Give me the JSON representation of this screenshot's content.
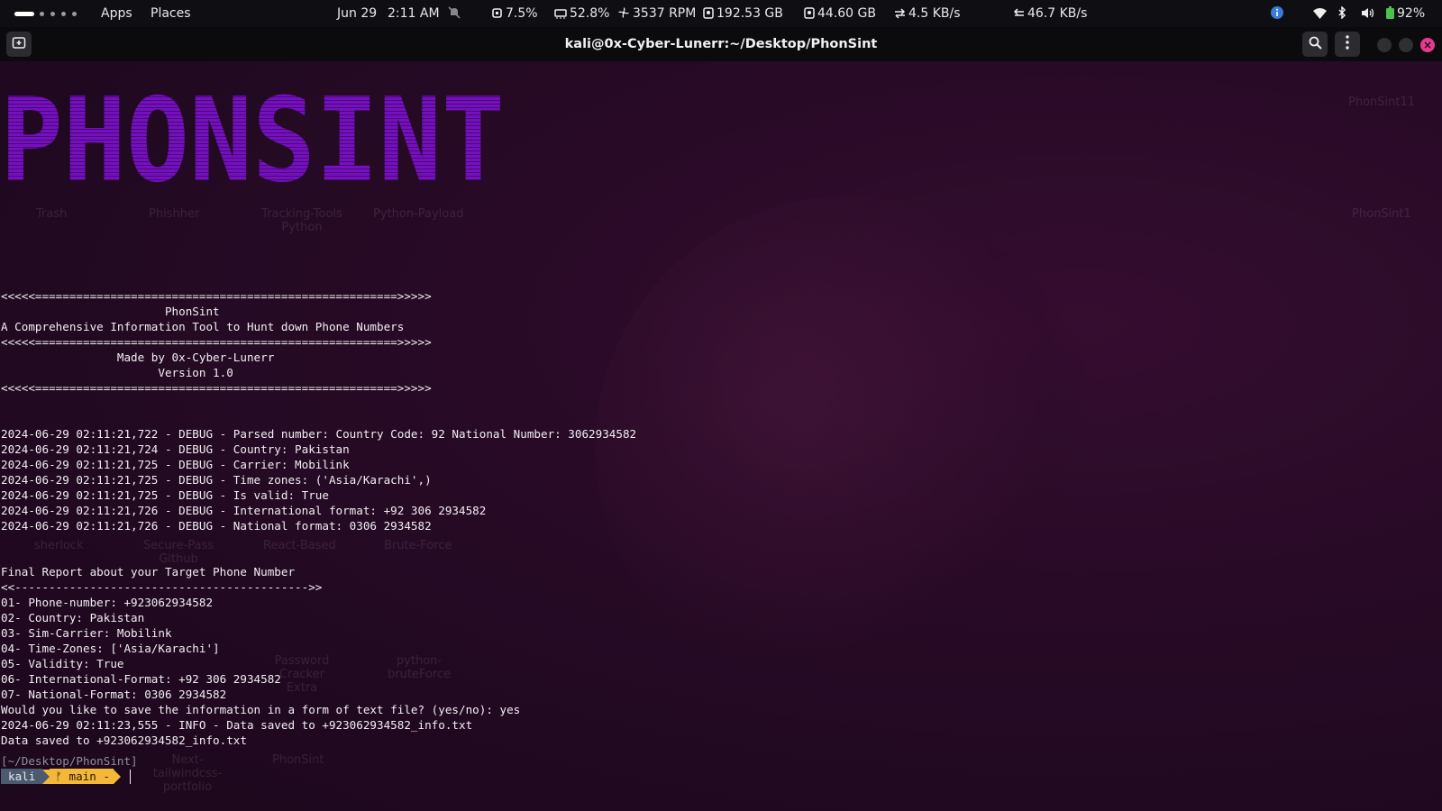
{
  "topbar": {
    "menu_apps": "Apps",
    "menu_places": "Places",
    "date": "Jun 29",
    "time": "2:11 AM",
    "cpu": "7.5%",
    "memory": "52.8%",
    "fan": "3537 RPM",
    "disk1": "192.53 GB",
    "disk2": "44.60 GB",
    "net_up": "4.5 KB/s",
    "net_down": "46.7 KB/s",
    "battery": "92%",
    "icons": [
      "notifications-off-icon",
      "cpu-icon",
      "memory-icon",
      "fan-icon",
      "disk-icon",
      "disk-icon",
      "upload-icon",
      "download-icon",
      "info-icon",
      "wifi-icon",
      "bluetooth-icon",
      "volume-icon",
      "battery-icon"
    ]
  },
  "window": {
    "title": "kali@0x-Cyber-Lunerr:~/Desktop/PhonSint",
    "buttons": [
      "new-tab-icon",
      "search-icon",
      "menu-icon",
      "minimize-button",
      "maximize-button",
      "close-button"
    ]
  },
  "terminal": {
    "banner": "PHONSINT",
    "lines": [
      "<<<<<=====================================================>>>>>",
      "                        PhonSint",
      "A Comprehensive Information Tool to Hunt down Phone Numbers",
      "<<<<<=====================================================>>>>>",
      "                 Made by 0x-Cyber-Lunerr",
      "                       Version 1.0",
      "<<<<<=====================================================>>>>>",
      "",
      "",
      "2024-06-29 02:11:21,722 - DEBUG - Parsed number: Country Code: 92 National Number: 3062934582",
      "2024-06-29 02:11:21,724 - DEBUG - Country: Pakistan",
      "2024-06-29 02:11:21,725 - DEBUG - Carrier: Mobilink",
      "2024-06-29 02:11:21,725 - DEBUG - Time zones: ('Asia/Karachi',)",
      "2024-06-29 02:11:21,725 - DEBUG - Is valid: True",
      "2024-06-29 02:11:21,726 - DEBUG - International format: +92 306 2934582",
      "2024-06-29 02:11:21,726 - DEBUG - National format: 0306 2934582",
      "",
      "",
      "Final Report about your Target Phone Number",
      "<<------------------------------------------->>",
      "01- Phone-number: +923062934582",
      "02- Country: Pakistan",
      "03- Sim-Carrier: Mobilink",
      "04- Time-Zones: ['Asia/Karachi']",
      "05- Validity: True",
      "06- International-Format: +92 306 2934582",
      "07- National-Format: 0306 2934582",
      "Would you like to save the information in a form of text file? (yes/no): yes",
      "2024-06-29 02:11:23,555 - INFO - Data saved to +923062934582_info.txt",
      "Data saved to +923062934582_info.txt",
      "",
      "[~/Desktop/PhonSint]"
    ],
    "prompt_user": "kali",
    "prompt_branch": "ᚠ main -"
  },
  "desktop_icons": [
    "Trash",
    "Phishher",
    "Tracking-Tools Python",
    "Python-Payload",
    "PhonSint11",
    "PhonSint1",
    "sherlock",
    "Secure-Pass Github",
    "React-Based",
    "Brute-Force",
    "Password Cracker Extra",
    "python-bruteForce",
    "PhonSint",
    "Next-tailwindcss-portfolio"
  ],
  "colors": {
    "accent_purple": "#7a10c8",
    "prompt_user_bg": "#4b5a6e",
    "prompt_branch_bg": "#f4b73a",
    "close_button": "#e63a8f"
  }
}
